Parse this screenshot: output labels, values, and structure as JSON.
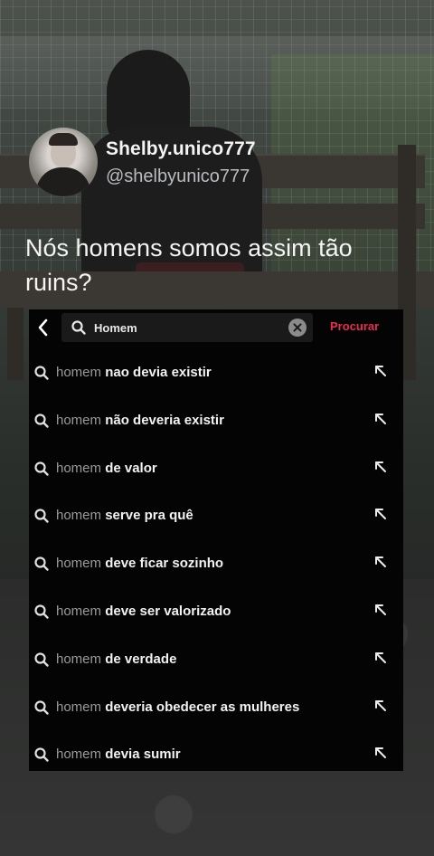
{
  "tweet": {
    "display_name": "Shelby.unico777",
    "handle": "@shelbyunico777",
    "text": "Nós homens somos assim tão ruins?"
  },
  "search": {
    "query": "Homem",
    "search_button_label": "Procurar",
    "back_icon": "chevron-left-icon",
    "clear_icon": "clear-circle-icon"
  },
  "suggestions": [
    {
      "prefix": "homem",
      "suffix": "nao devia existir"
    },
    {
      "prefix": "homem",
      "suffix": "não deveria existir"
    },
    {
      "prefix": "homem",
      "suffix": "de valor"
    },
    {
      "prefix": "homem",
      "suffix": "serve pra quê"
    },
    {
      "prefix": "homem",
      "suffix": "deve ficar sozinho"
    },
    {
      "prefix": "homem",
      "suffix": "deve ser valorizado"
    },
    {
      "prefix": "homem",
      "suffix": "de verdade"
    },
    {
      "prefix": "homem",
      "suffix": "deveria obedecer as mulheres"
    },
    {
      "prefix": "homem",
      "suffix": "devia sumir"
    }
  ],
  "colors": {
    "accent": "#e92d52",
    "panel_bg": "#040404"
  }
}
